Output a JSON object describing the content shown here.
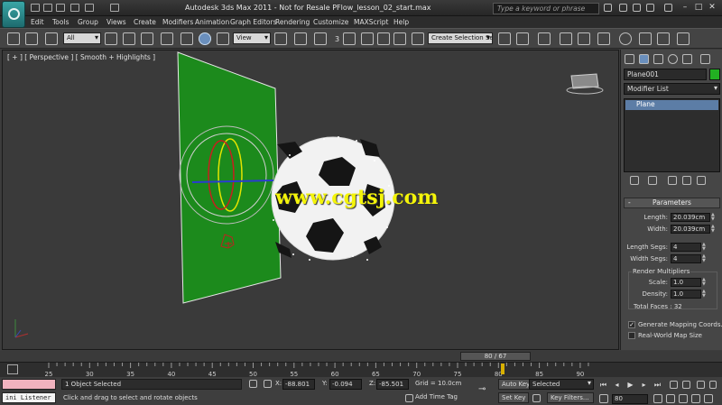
{
  "titlebar": {
    "title": "Autodesk 3ds Max  2011  - Not for Resale   PFlow_lesson_02_start.max",
    "search_placeholder": "Type a keyword or phrase",
    "window_controls": [
      "–",
      "□",
      "✕"
    ]
  },
  "menu": [
    "Edit",
    "Tools",
    "Group",
    "Views",
    "Create",
    "Modifiers",
    "Animation",
    "Graph Editors",
    "Rendering",
    "Customize",
    "MAXScript",
    "Help"
  ],
  "toolbar": {
    "selection_filter": "All",
    "reference_coord": "View",
    "snap_label": "3",
    "named_selection": "Create Selection Se"
  },
  "viewport": {
    "label": "[ + ] [ Perspective ] [ Smooth + Highlights ]",
    "watermark": "www.cgtsj.com"
  },
  "command_panel": {
    "object_name": "Plane001",
    "object_color": "#22b022",
    "modifier_list": "Modifier List",
    "stack_item": "Plane",
    "parameters_title": "Parameters",
    "dash": "-",
    "length_label": "Length:",
    "length_value": "20.039cm",
    "width_label": "Width:",
    "width_value": "20.039cm",
    "length_segs_label": "Length Segs:",
    "length_segs_value": "4",
    "width_segs_label": "Width Segs:",
    "width_segs_value": "4",
    "render_multipliers_label": "Render Multipliers",
    "scale_label": "Scale:",
    "scale_value": "1.0",
    "density_label": "Density:",
    "density_value": "1.0",
    "total_faces": "Total Faces : 32",
    "generate_mapping": "Generate Mapping Coords.",
    "generate_mapping_checked": true,
    "real_world_map": "Real-World Map Size",
    "real_world_map_checked": false
  },
  "timeline": {
    "slider_label": "80 / 67",
    "ticks": [
      "25",
      "30",
      "35",
      "40",
      "45",
      "50",
      "55",
      "60",
      "65",
      "70",
      "75",
      "80",
      "85",
      "90"
    ]
  },
  "status": {
    "listener": "ini Listener",
    "selection": "1 Object Selected",
    "prompt": "Click and drag to select and rotate objects",
    "x_label": "X:",
    "x_value": "-88.801",
    "y_label": "Y:",
    "y_value": "-0.094",
    "z_label": "Z:",
    "z_value": "-85.501",
    "grid": "Grid = 10.0cm",
    "add_time_tag": "Add Time Tag",
    "auto_key": "Auto Key",
    "set_key": "Set Key",
    "key_mode": "Selected",
    "key_filters": "Key Filters...",
    "frame": "80"
  }
}
